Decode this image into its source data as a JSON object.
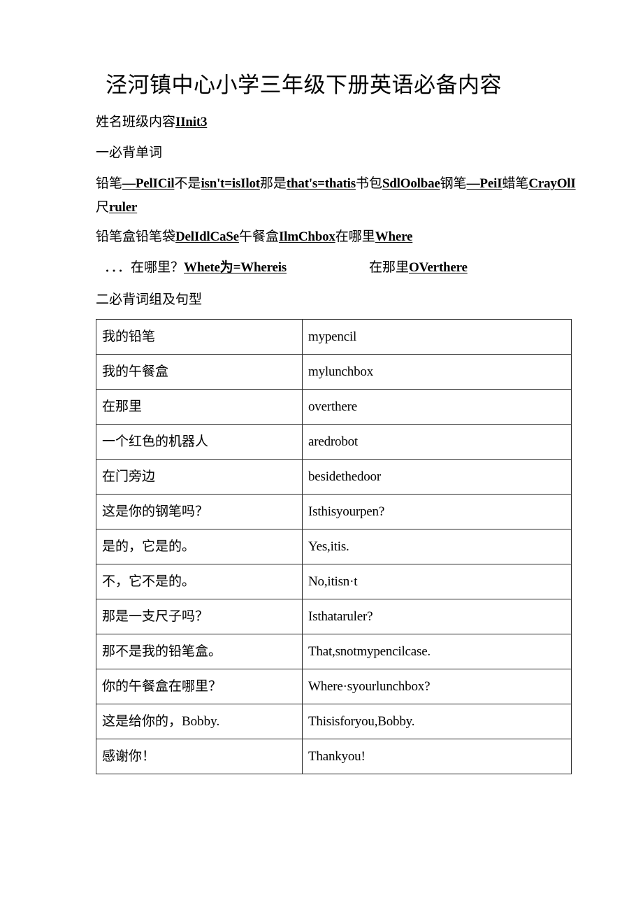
{
  "document": {
    "title": "泾河镇中心小学三年级下册英语必备内容",
    "subheader_cn": "姓名班级内容",
    "subheader_en": "IInit3",
    "section_one": "一必背单词",
    "section_two": "二必背词组及句型"
  },
  "vocab": {
    "line1": [
      {
        "type": "cn",
        "text": "铅笔"
      },
      {
        "type": "en",
        "text": "—PelICil"
      },
      {
        "type": "cn",
        "text": "不是"
      },
      {
        "type": "en",
        "text": "isn't=isIlot"
      },
      {
        "type": "cn",
        "text": "那是"
      },
      {
        "type": "en",
        "text": "that's=thatis"
      },
      {
        "type": "cn",
        "text": "书包"
      },
      {
        "type": "en",
        "text": "SdlOolbae"
      },
      {
        "type": "cn",
        "text": "钢笔"
      },
      {
        "type": "en",
        "text": "—PeiI"
      },
      {
        "type": "cn",
        "text": "蜡笔"
      },
      {
        "type": "en",
        "text": "CrayOlI"
      },
      {
        "type": "cn",
        "text": "尺"
      },
      {
        "type": "en",
        "text": "ruler"
      }
    ],
    "line2": [
      {
        "type": "cn",
        "text": "铅笔盒铅笔袋"
      },
      {
        "type": "en",
        "text": "DelIdlCaSe"
      },
      {
        "type": "cn",
        "text": "午餐盒"
      },
      {
        "type": "en",
        "text": "IlmChbox"
      },
      {
        "type": "cn",
        "text": "在哪里"
      },
      {
        "type": "en",
        "text": "Where"
      }
    ],
    "line3": [
      {
        "type": "cn",
        "text": "．．．在哪里？"
      },
      {
        "type": "en",
        "text": "Whete为=Whereis"
      },
      {
        "type": "gap",
        "text": ""
      },
      {
        "type": "cn",
        "text": "在那里"
      },
      {
        "type": "en",
        "text": "OVerthere"
      }
    ]
  },
  "table": {
    "rows": [
      {
        "cn": "我的铅笔",
        "en": "mypencil"
      },
      {
        "cn": "我的午餐盒",
        "en": "mylunchbox"
      },
      {
        "cn": "在那里",
        "en": "overthere"
      },
      {
        "cn": "一个红色的机器人",
        "en": "aredrobot"
      },
      {
        "cn": "在门旁边",
        "en": "besidethedoor"
      },
      {
        "cn": "这是你的钢笔吗？",
        "en": "Isthisyourpen?"
      },
      {
        "cn": "是的，它是的。",
        "en": "Yes,itis."
      },
      {
        "cn": "不，它不是的。",
        "en": "No,itisn·t"
      },
      {
        "cn": "那是一支尺子吗？",
        "en": "Isthataruler?"
      },
      {
        "cn": "那不是我的铅笔盒。",
        "en": "That,snotmypencilcase."
      },
      {
        "cn": "你的午餐盒在哪里？",
        "en": "Where·syourlunchbox?"
      },
      {
        "cn": "这是给你的，Bobby.",
        "en": "Thisisforyou,Bobby."
      },
      {
        "cn": "感谢你！",
        "en": "Thankyou!"
      }
    ]
  }
}
